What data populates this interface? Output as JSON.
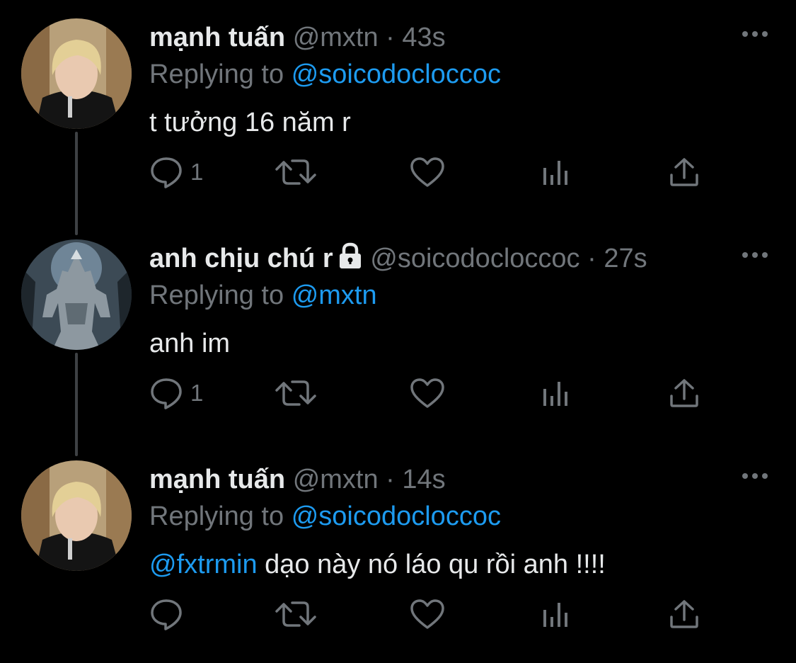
{
  "tweets": [
    {
      "name": "mạnh tuấn",
      "handle": "@mxtn",
      "separator": "·",
      "time": "43s",
      "replying_prefix": "Replying to",
      "replying_to": "@soicodocloccoc",
      "mention": "",
      "text": "t tưởng 16 năm r",
      "reply_count": "1",
      "locked": false
    },
    {
      "name": "anh chịu chú r",
      "handle": "@soicodocloccoc",
      "separator": "·",
      "time": "27s",
      "replying_prefix": "Replying to",
      "replying_to": "@mxtn",
      "mention": "",
      "text": "anh im",
      "reply_count": "1",
      "locked": true
    },
    {
      "name": "mạnh tuấn",
      "handle": "@mxtn",
      "separator": "·",
      "time": "14s",
      "replying_prefix": "Replying to",
      "replying_to": "@soicodocloccoc",
      "mention": "@fxtrmin",
      "text": " dạo này nó láo qu rồi anh !!!!",
      "reply_count": "",
      "locked": false
    }
  ],
  "icons": {
    "avatar_1": "blond-person-avatar",
    "avatar_2": "werewolf-avatar",
    "lock": "lock-icon",
    "more": "more-icon",
    "reply": "reply-icon",
    "retweet": "retweet-icon",
    "like": "heart-icon",
    "views": "analytics-icon",
    "share": "share-icon"
  },
  "colors": {
    "background": "#000000",
    "primary_text": "#e7e9ea",
    "secondary_text": "#71767b",
    "link": "#1d9bf0",
    "thread_line": "#3e4144"
  }
}
